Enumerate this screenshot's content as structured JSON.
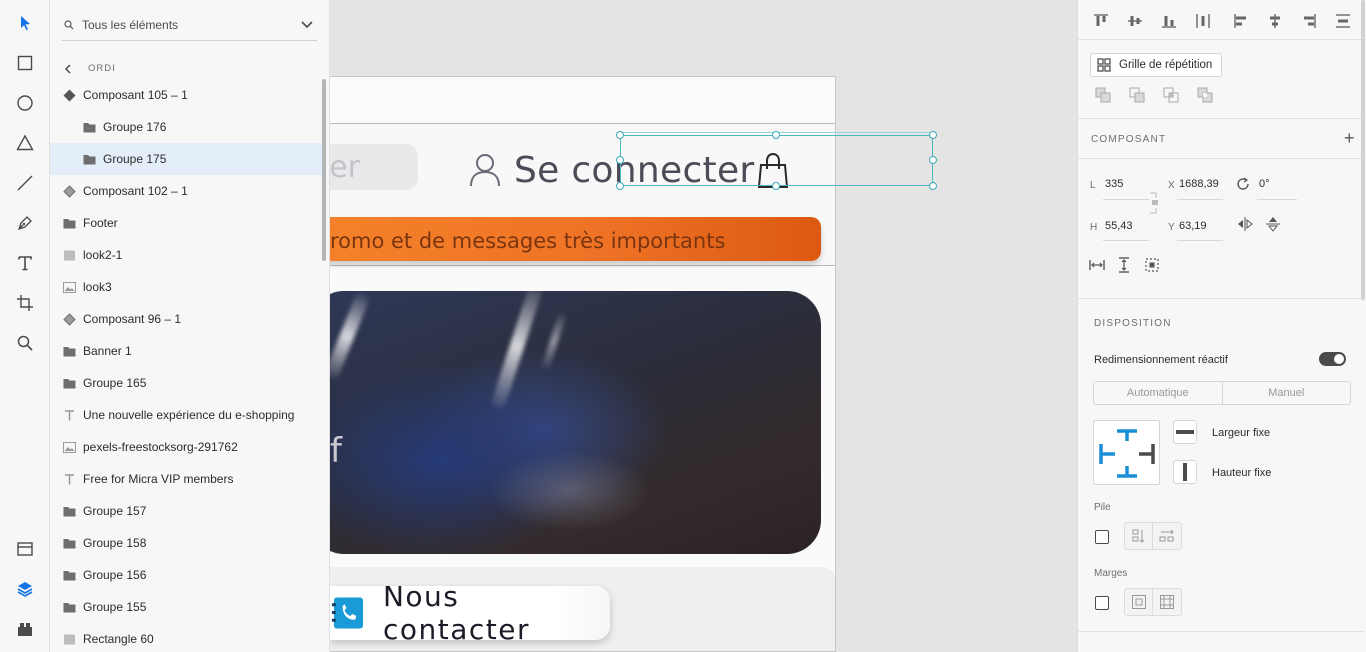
{
  "toolbar": {
    "tools": [
      "select-tool",
      "rectangle-tool",
      "ellipse-tool",
      "polygon-tool",
      "line-tool",
      "pen-tool",
      "text-tool",
      "artboard-tool",
      "zoom-tool"
    ],
    "bottom": [
      "assets-tool",
      "layers-tool",
      "plugins-tool"
    ],
    "accent": "#1473e6"
  },
  "layers": {
    "filter_value": "Tous les éléments",
    "breadcrumb": "ORDI",
    "items": [
      {
        "label": "Composant 105 – 1",
        "icon": "component-main-icon",
        "indent": 0
      },
      {
        "label": "Groupe 176",
        "icon": "folder-icon",
        "indent": 1
      },
      {
        "label": "Groupe 175",
        "icon": "folder-icon",
        "indent": 1,
        "selected": true
      },
      {
        "label": "Composant 102 – 1",
        "icon": "component-icon",
        "indent": 0
      },
      {
        "label": "Footer",
        "icon": "folder-icon",
        "indent": 0
      },
      {
        "label": "look2-1",
        "icon": "rectangle-icon",
        "indent": 0
      },
      {
        "label": "look3",
        "icon": "image-icon",
        "indent": 0
      },
      {
        "label": "Composant 96 – 1",
        "icon": "component-icon",
        "indent": 0
      },
      {
        "label": "Banner 1",
        "icon": "folder-icon",
        "indent": 0
      },
      {
        "label": "Groupe 165",
        "icon": "folder-icon",
        "indent": 0
      },
      {
        "label": "Une nouvelle expérience du  e-shopping",
        "icon": "text-icon",
        "indent": 0
      },
      {
        "label": "pexels-freestocksorg-291762",
        "icon": "image-icon",
        "indent": 0
      },
      {
        "label": "Free for Micra VIP members",
        "icon": "text-icon",
        "indent": 0
      },
      {
        "label": "Groupe 157",
        "icon": "folder-icon",
        "indent": 0
      },
      {
        "label": "Groupe 158",
        "icon": "folder-icon",
        "indent": 0
      },
      {
        "label": "Groupe 156",
        "icon": "folder-icon",
        "indent": 0
      },
      {
        "label": "Groupe 155",
        "icon": "folder-icon",
        "indent": 0
      },
      {
        "label": "Rectangle 60",
        "icon": "rectangle-icon",
        "indent": 0
      }
    ]
  },
  "canvas": {
    "search_partial": "er",
    "login_label": "Se connecter",
    "promo_text": "romo et de messages très importants",
    "banner_partial": "f",
    "contact_label": "Nous contacter",
    "selection_color": "#4cb7c4"
  },
  "inspector": {
    "repeat_grid_label": "Grille de répétition",
    "component_title": "COMPOSANT",
    "fields": {
      "l_label": "L",
      "l_value": "335",
      "x_label": "X",
      "x_value": "1688,39",
      "rotation": "0°",
      "h_label": "H",
      "h_value": "55,43",
      "y_label": "Y",
      "y_value": "63,19"
    },
    "layout_title": "DISPOSITION",
    "responsive_label": "Redimensionnement réactif",
    "responsive_on": true,
    "seg_auto": "Automatique",
    "seg_manual": "Manuel",
    "fixed_width": "Largeur fixe",
    "fixed_height": "Hauteur fixe",
    "stack_label": "Pile",
    "padding_label": "Marges",
    "constraint_color": "#1a8fd8"
  }
}
